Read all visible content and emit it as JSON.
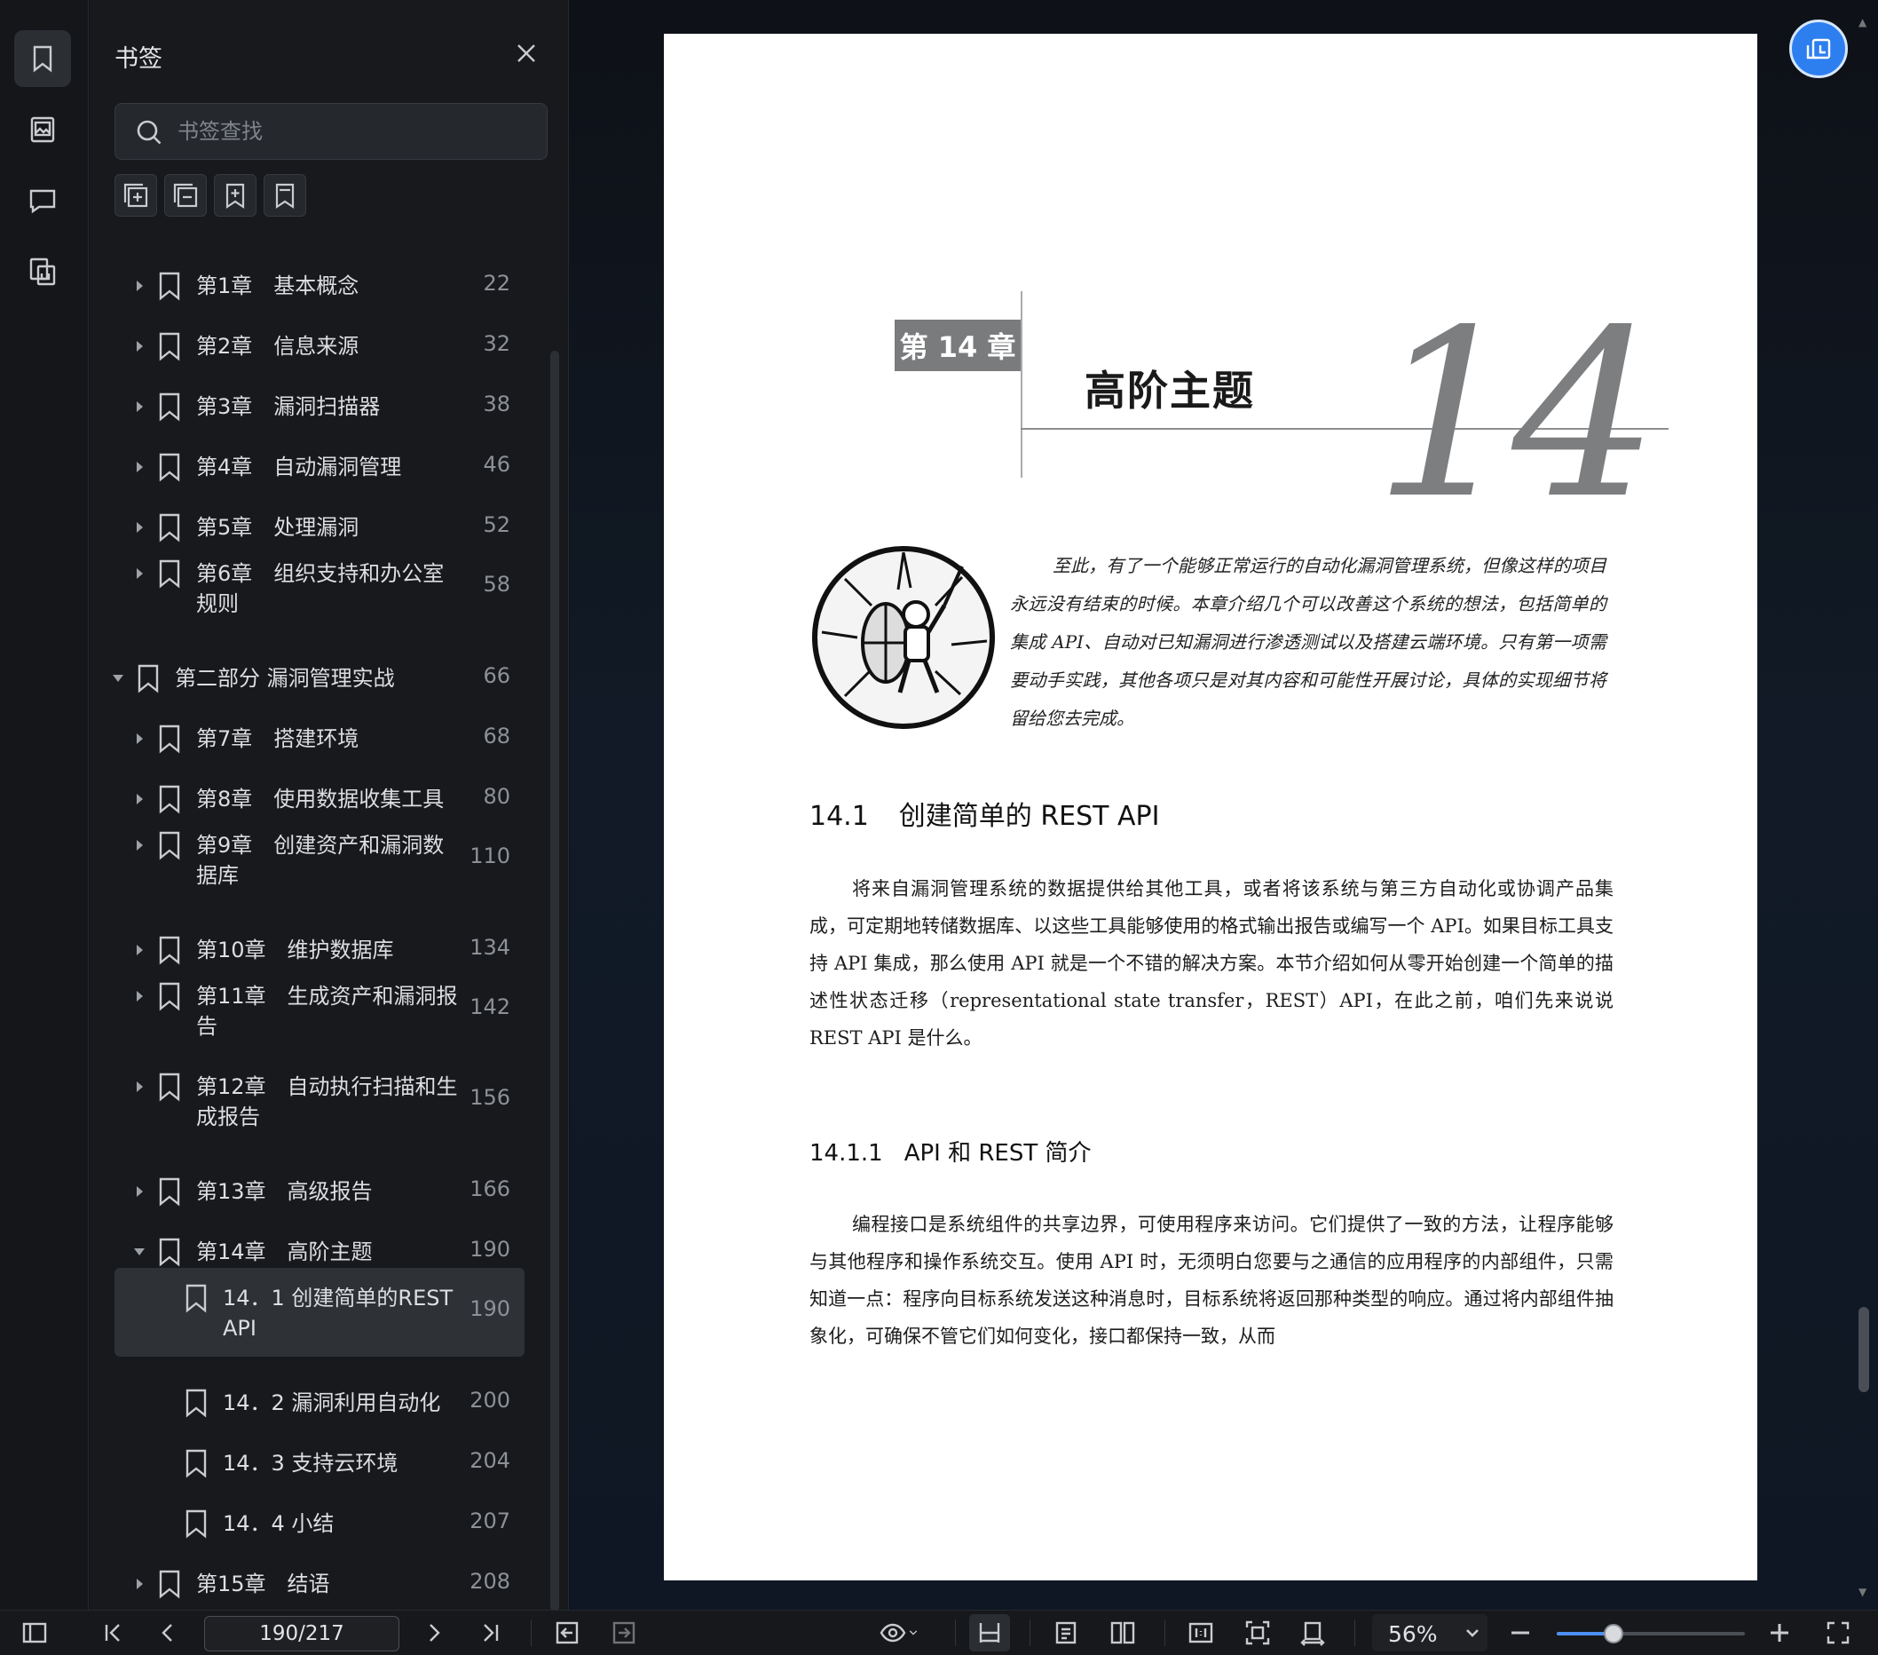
{
  "sidebar": {
    "title": "书签",
    "search_placeholder": "书签查找",
    "items": [
      {
        "label": "第1章　基本概念",
        "page": "22",
        "level": 1,
        "arrow": "right"
      },
      {
        "label": "第2章　信息来源",
        "page": "32",
        "level": 1,
        "arrow": "right"
      },
      {
        "label": "第3章　漏洞扫描器",
        "page": "38",
        "level": 1,
        "arrow": "right"
      },
      {
        "label": "第4章　自动漏洞管理",
        "page": "46",
        "level": 1,
        "arrow": "right"
      },
      {
        "label": "第5章　处理漏洞",
        "page": "52",
        "level": 1,
        "arrow": "right"
      },
      {
        "label": "第6章　组织支持和办公室\n规则",
        "page": "58",
        "level": 1,
        "arrow": "right"
      },
      {
        "label": "第二部分 漏洞管理实战",
        "page": "66",
        "level": 0,
        "arrow": "down"
      },
      {
        "label": "第7章　搭建环境",
        "page": "68",
        "level": 1,
        "arrow": "right"
      },
      {
        "label": "第8章　使用数据收集工具",
        "page": "80",
        "level": 1,
        "arrow": "right"
      },
      {
        "label": "第9章　创建资产和漏洞数\n据库",
        "page": "110",
        "level": 1,
        "arrow": "right"
      },
      {
        "label": "第10章　维护数据库",
        "page": "134",
        "level": 1,
        "arrow": "right"
      },
      {
        "label": "第11章　生成资产和漏洞报\n告",
        "page": "142",
        "level": 1,
        "arrow": "right"
      },
      {
        "label": "第12章　自动执行扫描和生\n成报告",
        "page": "156",
        "level": 1,
        "arrow": "right"
      },
      {
        "label": "第13章　高级报告",
        "page": "166",
        "level": 1,
        "arrow": "right"
      },
      {
        "label": "第14章　高阶主题",
        "page": "190",
        "level": 1,
        "arrow": "down"
      },
      {
        "label": "14．1 创建简单的REST\nAPI",
        "page": "190",
        "level": 2,
        "arrow": "none",
        "active": true
      },
      {
        "label": "14．2 漏洞利用自动化",
        "page": "200",
        "level": 2,
        "arrow": "none"
      },
      {
        "label": "14．3 支持云环境",
        "page": "204",
        "level": 2,
        "arrow": "none"
      },
      {
        "label": "14．4 小结",
        "page": "207",
        "level": 2,
        "arrow": "none"
      },
      {
        "label": "第15章　结语",
        "page": "208",
        "level": 1,
        "arrow": "right"
      }
    ]
  },
  "document": {
    "chapter_tag": "第 14 章",
    "chapter_title": "高阶主题",
    "chapter_number": "14",
    "intro": "至此，有了一个能够正常运行的自动化漏洞管理系统，但像这样的项目永远没有结束的时候。本章介绍几个可以改善这个系统的想法，包括简单的集成 API、自动对已知漏洞进行渗透测试以及搭建云端环境。只有第一项需要动手实践，其他各项只是对其内容和可能性开展讨论，具体的实现细节将留给您去完成。",
    "section1_num": "14.1",
    "section1_title": "创建简单的 REST API",
    "section1_text": "将来自漏洞管理系统的数据提供给其他工具，或者将该系统与第三方自动化或协调产品集成，可定期地转储数据库、以这些工具能够使用的格式输出报告或编写一个 API。如果目标工具支持 API 集成，那么使用 API 就是一个不错的解决方案。本节介绍如何从零开始创建一个简单的描述性状态迁移（representational state transfer，REST）API，在此之前，咱们先来说说 REST API 是什么。",
    "section2_num": "14.1.1",
    "section2_title": "API 和 REST 简介",
    "section2_text": "编程接口是系统组件的共享边界，可使用程序来访问。它们提供了一致的方法，让程序能够与其他程序和操作系统交互。使用 API 时，无须明白您要与之通信的应用程序的内部组件，只需知道一点：程序向目标系统发送这种消息时，目标系统将返回那种类型的响应。通过将内部组件抽象化，可确保不管它们如何变化，接口都保持一致，从而"
  },
  "toolbar": {
    "page_indicator": "190/217",
    "zoom": "56%",
    "zoom_fraction": 0.3
  }
}
